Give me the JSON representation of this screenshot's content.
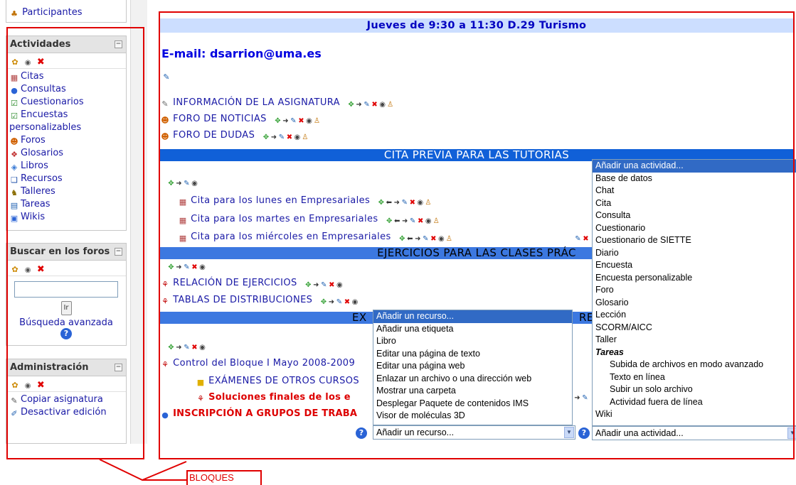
{
  "sidebar": {
    "participants": "Participantes",
    "activities_block": {
      "title": "Actividades",
      "collapse": "−",
      "items": [
        "Citas",
        "Consultas",
        "Cuestionarios",
        "Encuestas personalizables",
        "Foros",
        "Glosarios",
        "Libros",
        "Recursos",
        "Talleres",
        "Tareas",
        "Wikis"
      ]
    },
    "search_block": {
      "title": "Buscar en los foros",
      "collapse": "−",
      "go_label": "Ir",
      "advanced_link": "Búsqueda avanzada",
      "help": "?"
    },
    "admin_block": {
      "title": "Administración",
      "collapse": "−",
      "items": [
        "Copiar asignatura",
        "Desactivar edición"
      ]
    }
  },
  "main": {
    "topic_heading": "Jueves de 9:30 a 11:30 D.29 Turismo",
    "email": "E-mail: dsarrion@uma.es",
    "top_items": [
      "INFORMACIÓN DE LA ASIGNATURA",
      "FORO DE NOTICIAS",
      "FORO DE DUDAS"
    ],
    "section_tutorias": {
      "title": "CITA PREVIA PARA LAS TUTORIAS",
      "items": [
        "Cita para los lunes en Empresariales",
        "Cita para los martes en Empresariales",
        "Cita para los miércoles en Empresariales"
      ]
    },
    "section_ejercicios": {
      "title": "EJERCICIOS PARA LAS CLASES PRÁC",
      "items": [
        "RELACIÓN DE EJERCICIOS",
        "TABLAS DE DISTRIBUCIONES"
      ]
    },
    "section_examenes": {
      "title_left": "EX",
      "title_right": "RE",
      "items": [
        "Control del Bloque I Mayo 2008-2009",
        "EXÁMENES DE OTROS CURSOS",
        "Soluciones finales de los e"
      ],
      "signup": "INSCRIPCIÓN A GRUPOS DE TRABA"
    },
    "help": "?"
  },
  "resource_dropdown": {
    "selected": "Añadir un recurso...",
    "options": [
      "Añadir un recurso...",
      "Añadir una etiqueta",
      "Libro",
      "Editar una página de texto",
      "Editar una página web",
      "Enlazar un archivo o una dirección web",
      "Mostrar una carpeta",
      "Desplegar Paquete de contenidos IMS",
      "Visor de moléculas 3D"
    ]
  },
  "activity_dropdown": {
    "selected": "Añadir una actividad...",
    "options": [
      "Añadir una actividad...",
      "Base de datos",
      "Chat",
      "Cita",
      "Consulta",
      "Cuestionario",
      "Cuestionario de SIETTE",
      "Diario",
      "Encuesta",
      "Encuesta personalizable",
      "Foro",
      "Glosario",
      "Lección",
      "SCORM/AICC",
      "Taller"
    ],
    "group_label": "Tareas",
    "group_options": [
      "Subida de archivos en modo avanzado",
      "Texto en línea",
      "Subir un solo archivo",
      "Actividad fuera de línea"
    ],
    "last_option": "Wiki"
  },
  "annotation": {
    "label": "BLOQUES",
    "color": "#e00000"
  },
  "colors": {
    "section_bar": "#1060d8",
    "topic_bar": "#ccdeff",
    "link": "#1a1aa6",
    "highlight": "#316ac5"
  }
}
